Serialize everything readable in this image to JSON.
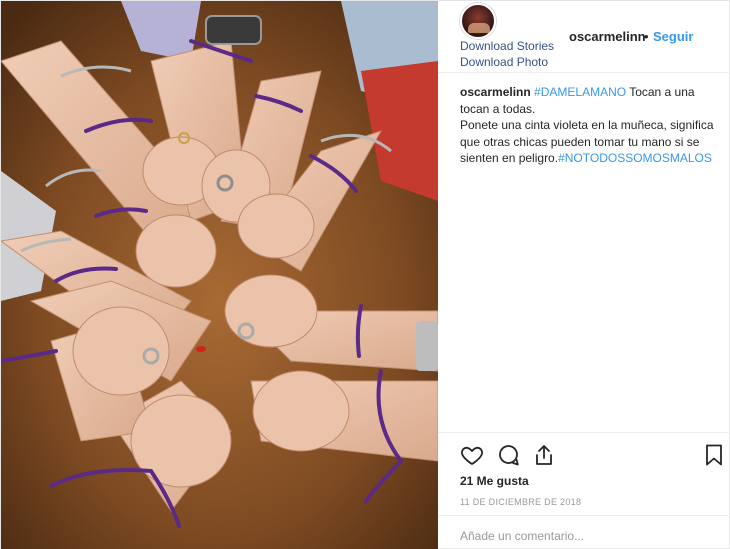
{
  "post": {
    "author": {
      "username": "oscarmelinn",
      "follow_label": "Seguir",
      "separator": "•"
    },
    "download": {
      "stories_label": "Download Stories",
      "photo_label": "Download Photo"
    },
    "caption": {
      "username": "oscarmelinn",
      "hashtag1": "#DAMELAMANO",
      "text1": " Tocan a una tocan a todas.",
      "text2": "Ponete una cinta violeta en la muñeca, significa que otras chicas pueden tomar tu mano si se sienten en peligro.",
      "hashtag2": "#NOTODOSSOMOSMALOS"
    },
    "likes_label": "21 Me gusta",
    "date_label": "11 DE DICIEMBRE DE 2018",
    "comment_placeholder": "Añade un comentario...",
    "icons": {
      "like": "heart-icon",
      "comment": "comment-icon",
      "share": "share-icon",
      "save": "bookmark-icon"
    },
    "colors": {
      "link": "#3897f0",
      "download_link": "#385185",
      "ribbon": "#5b2a86",
      "table": "#7a4a22"
    }
  }
}
